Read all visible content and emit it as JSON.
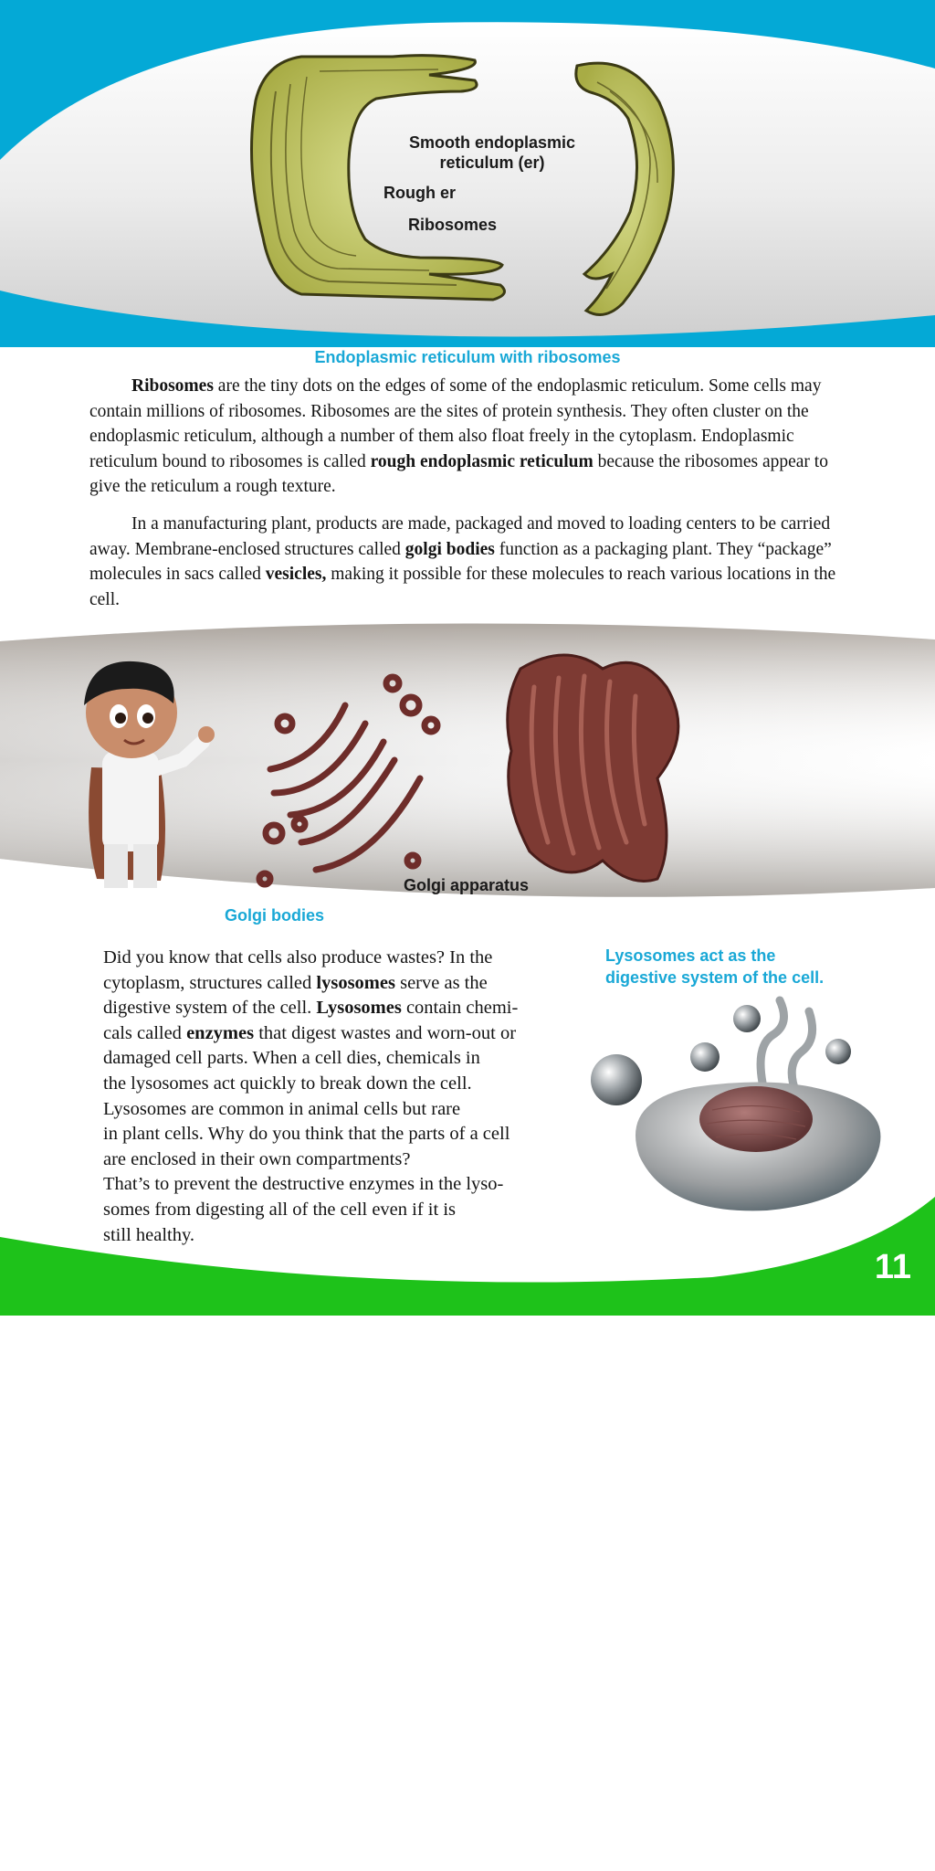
{
  "colors": {
    "accent_blue": "#19a8d6",
    "accent_green": "#1ec21a",
    "body_text": "#141414"
  },
  "er_figure": {
    "label_smooth_line1": "Smooth endoplasmic",
    "label_smooth_line2": "reticulum (er)",
    "label_rough": "Rough er",
    "label_ribosomes": "Ribosomes",
    "caption": "Endoplasmic reticulum with ribosomes"
  },
  "paragraph1": {
    "t1": "Ribosomes",
    "t2": " are the tiny dots on the edges of some of the endoplasmic reticulum. Some cells may contain millions of ribosomes. Ribosomes are the sites of protein synthesis. They often cluster on the endoplasmic reticulum, although a number of them also float freely in the cytoplasm. Endoplasmic reticulum bound to ribosomes is called ",
    "t3": "rough endoplasmic reticulum",
    "t4": " because the ribosomes appear to give the reticulum a rough texture."
  },
  "paragraph2": {
    "t1": "In a manufacturing plant, products are made, packaged and moved to loading centers to be carried away. Membrane-enclosed structures called ",
    "t2": "golgi bodies",
    "t3": " function as a packaging plant. They “package” molecules in sacs called ",
    "t4": "vesicles,",
    "t5": " making it possible for these molecules to reach various locations in the cell."
  },
  "golgi_figure": {
    "label_apparatus": "Golgi apparatus",
    "caption": "Golgi bodies"
  },
  "lysosome_figure": {
    "caption_line1": "Lysosomes act as the",
    "caption_line2": "digestive system of the cell."
  },
  "lysosome_text": {
    "l1": "Did you know that cells also produce wastes? In the",
    "l2a": "cytoplasm, structures called ",
    "l2b": "lysosomes",
    "l2c": " serve as the",
    "l3a": "digestive system of the cell. ",
    "l3b": "Lysosomes",
    "l3c": " contain chemi-",
    "l4a": "cals called ",
    "l4b": "enzymes",
    "l4c": " that digest wastes and worn-out or",
    "l5": "damaged cell parts. When a cell dies, chemicals in",
    "l6": "the lysosomes act quickly to break down the cell.",
    "l7": "Lysosomes are common in animal cells but rare",
    "l8": "in plant cells. Why do you think that the parts of a cell",
    "l9": "are enclosed in their own compartments?",
    "l10": "That’s to prevent the destructive enzymes in the lyso-",
    "l11": "somes from digesting all of the cell even if it is",
    "l12": "still healthy."
  },
  "page_number": "11"
}
